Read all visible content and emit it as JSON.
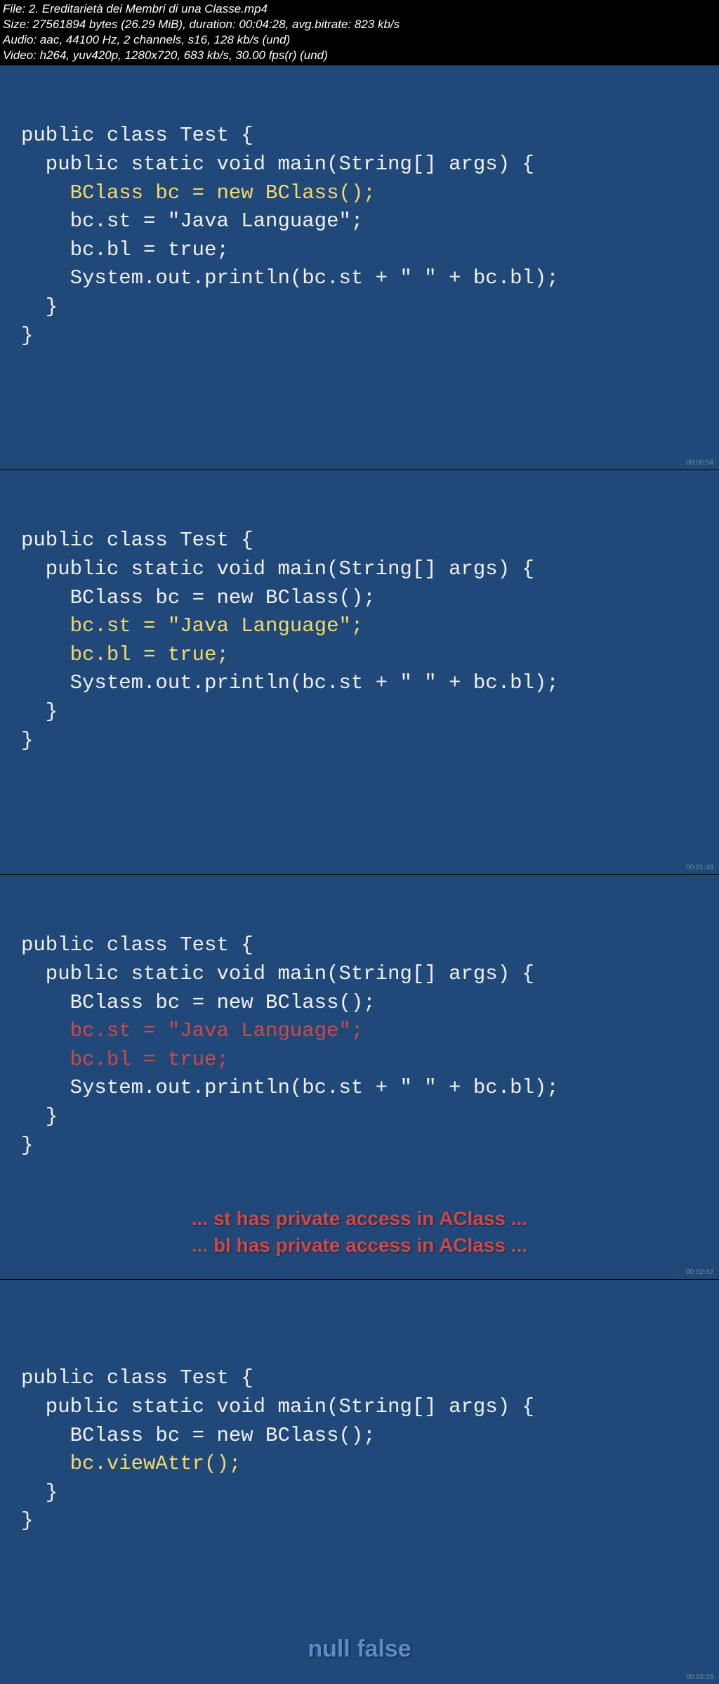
{
  "meta": {
    "file": "File: 2. Ereditarietà dei Membri di una Classe.mp4",
    "size": "Size: 27561894 bytes (26.29 MiB), duration: 00:04:28, avg.bitrate: 823 kb/s",
    "audio": "Audio: aac, 44100 Hz, 2 channels, s16, 128 kb/s (und)",
    "video": "Video: h264, yuv420p, 1280x720, 683 kb/s, 30.00 fps(r) (und)"
  },
  "frames": {
    "f1": {
      "l1": "public class Test {",
      "l2": "  public static void main(String[] args) {",
      "l3": "    BClass bc = new BClass();",
      "l4": "    bc.st = \"Java Language\";",
      "l5": "    bc.bl = true;",
      "l6": "    System.out.println(bc.st + \" \" + bc.bl);",
      "l7": "  }",
      "l8": "}",
      "ts": "00:00:54"
    },
    "f2": {
      "l1": "public class Test {",
      "l2": "  public static void main(String[] args) {",
      "l3": "    BClass bc = new BClass();",
      "l4": "    bc.st = \"Java Language\";",
      "l5": "    bc.bl = true;",
      "l6": "    System.out.println(bc.st + \" \" + bc.bl);",
      "l7": "  }",
      "l8": "}",
      "ts": "00:01:48"
    },
    "f3": {
      "l1": "public class Test {",
      "l2": "  public static void main(String[] args) {",
      "l3": "    BClass bc = new BClass();",
      "l4": "    bc.st = \"Java Language\";",
      "l5": "    bc.bl = true;",
      "l6": "    System.out.println(bc.st + \" \" + bc.bl);",
      "l7": "  }",
      "l8": "}",
      "err1": "... st has private access in AClass ...",
      "err2": "... bl has private access in AClass ...",
      "ts": "00:02:42"
    },
    "f4": {
      "l1": "public class Test {",
      "l2": "  public static void main(String[] args) {",
      "l3": "    BClass bc = new BClass();",
      "l4": "    bc.viewAttr();",
      "l5": "  }",
      "l6": "}",
      "out": "null false",
      "ts": "00:03:36"
    }
  }
}
